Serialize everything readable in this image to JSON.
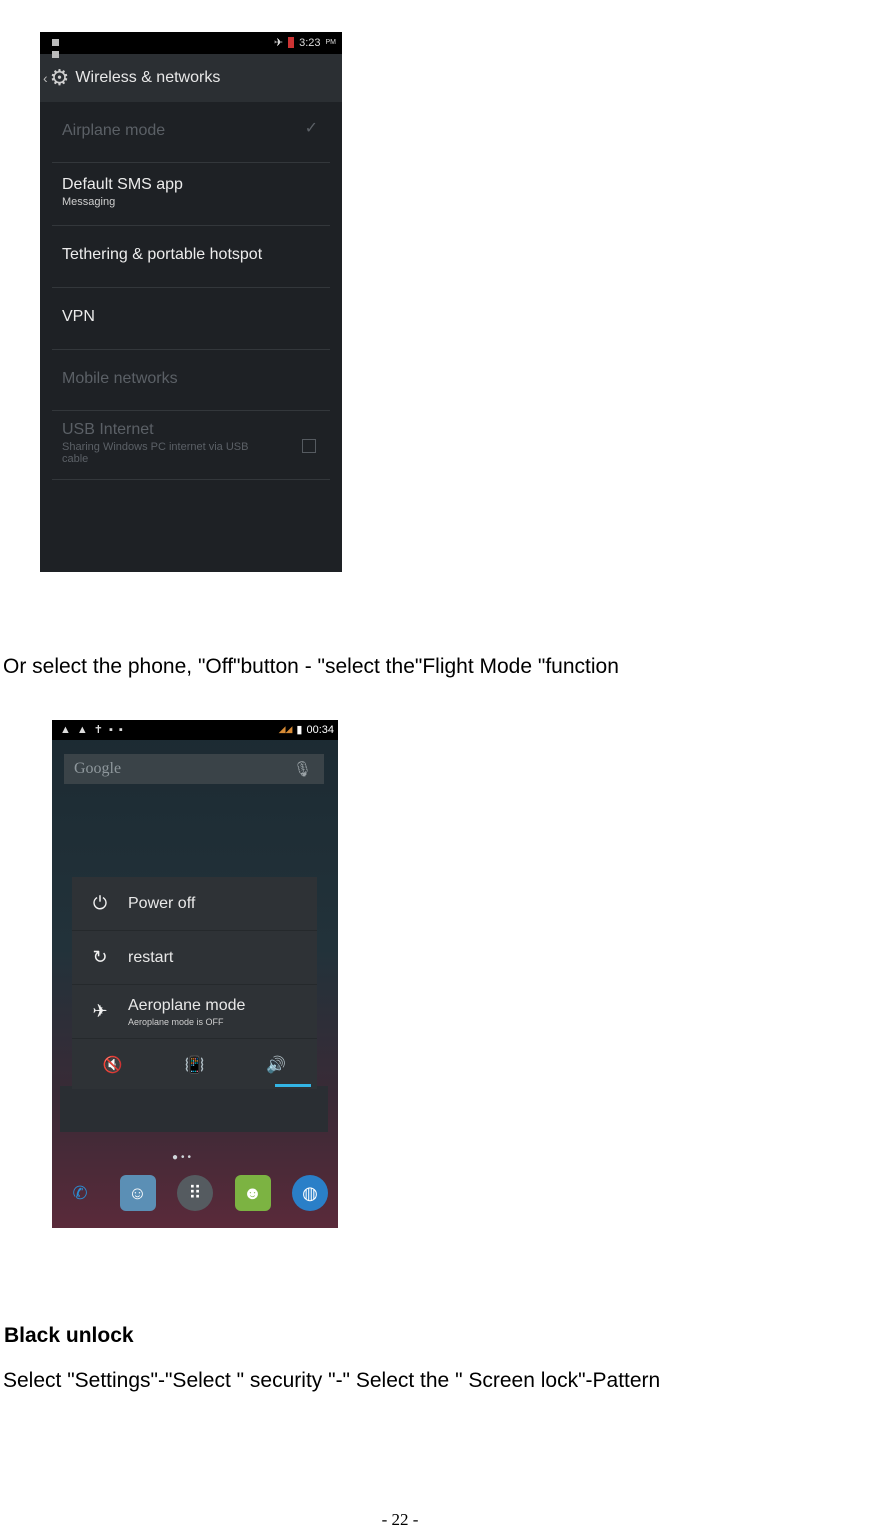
{
  "screenshot1": {
    "status_time": "3:23",
    "status_ampm": "PM",
    "title": "Wireless & networks",
    "icons": {
      "back": "chevron-left-icon",
      "settings": "gear-icon",
      "airplane": "airplane-icon"
    },
    "items": [
      {
        "title": "Airplane mode",
        "subtitle": "",
        "enabled": false,
        "control": "checkmark"
      },
      {
        "title": "Default SMS app",
        "subtitle": "Messaging",
        "enabled": true,
        "control": ""
      },
      {
        "title": "Tethering & portable hotspot",
        "subtitle": "",
        "enabled": true,
        "control": ""
      },
      {
        "title": "VPN",
        "subtitle": "",
        "enabled": true,
        "control": ""
      },
      {
        "title": "Mobile networks",
        "subtitle": "",
        "enabled": false,
        "control": ""
      },
      {
        "title": "USB Internet",
        "subtitle": "Sharing Windows PC internet via USB cable",
        "enabled": false,
        "control": "checkbox"
      }
    ]
  },
  "paragraph1": "Or select the phone, \"Off\"button - \"select the\"Flight Mode \"function",
  "screenshot2": {
    "status_time": "00:34",
    "search_placeholder": "Google",
    "menu": {
      "power_off": "Power off",
      "restart": "restart",
      "aeroplane": "Aeroplane mode",
      "aeroplane_sub": "Aeroplane mode is OFF"
    },
    "icons": {
      "power": "power-icon",
      "restart": "restart-icon",
      "aeroplane": "airplane-icon",
      "silent": "silent-icon",
      "vibrate": "vibrate-icon",
      "sound": "sound-icon",
      "mic": "mic-icon"
    },
    "accent": "#33b5e5"
  },
  "heading": "Black unlock",
  "paragraph2": "Select \"Settings\"-\"Select \" security \"-\" Select the \" Screen lock\"-Pattern",
  "page_number": "- 22 -"
}
